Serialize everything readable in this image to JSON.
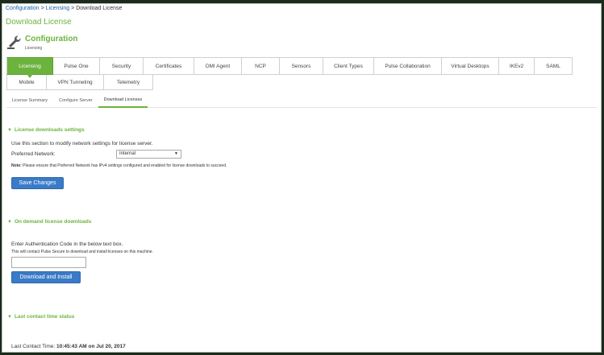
{
  "breadcrumb": {
    "item1": "Configuration",
    "sep1": " > ",
    "item2": "Licensing",
    "sep2": " > ",
    "current": "Download License"
  },
  "page_heading": "Download License",
  "config": {
    "title": "Configuration",
    "subtitle": "Licensing"
  },
  "tabs_row1": [
    "Licensing",
    "Pulse One",
    "Security",
    "Certificates",
    "DMI Agent",
    "NCP",
    "Sensors",
    "Client Types",
    "Pulse Collaboration",
    "Virtual Desktops",
    "IKEv2",
    "SAML"
  ],
  "tabs_row2": [
    "Mobile",
    "VPN Tunneling",
    "Telemetry"
  ],
  "subtabs": [
    "License Summary",
    "Configure Server",
    "Download Licenses"
  ],
  "section1": {
    "header": "License downloads settings",
    "description": "Use this section to modify network settings for license server.",
    "preferred_label": "Preferred Network:",
    "preferred_value": "Internal",
    "note_label": "Note:",
    "note_text": " Please ensure that Preferred Network has IPv4 settings configured and enabled for license downloads to succeed.",
    "save_button": "Save Changes"
  },
  "section2": {
    "header": "On demand license downloads",
    "instruction": "Enter Authentication Code in the below text box.",
    "sub_instruction": "This will contact Pulse Secure to download and install licenses on this machine.",
    "auth_value": "",
    "download_button": "Download and Install"
  },
  "section3": {
    "header": "Last contact time status",
    "label": "Last Contact Time:",
    "value": "10:45:43 AM on Jul 20, 2017"
  },
  "colors": {
    "accent": "#6cb33e",
    "button": "#3a7bc8",
    "link": "#1a5faa"
  }
}
